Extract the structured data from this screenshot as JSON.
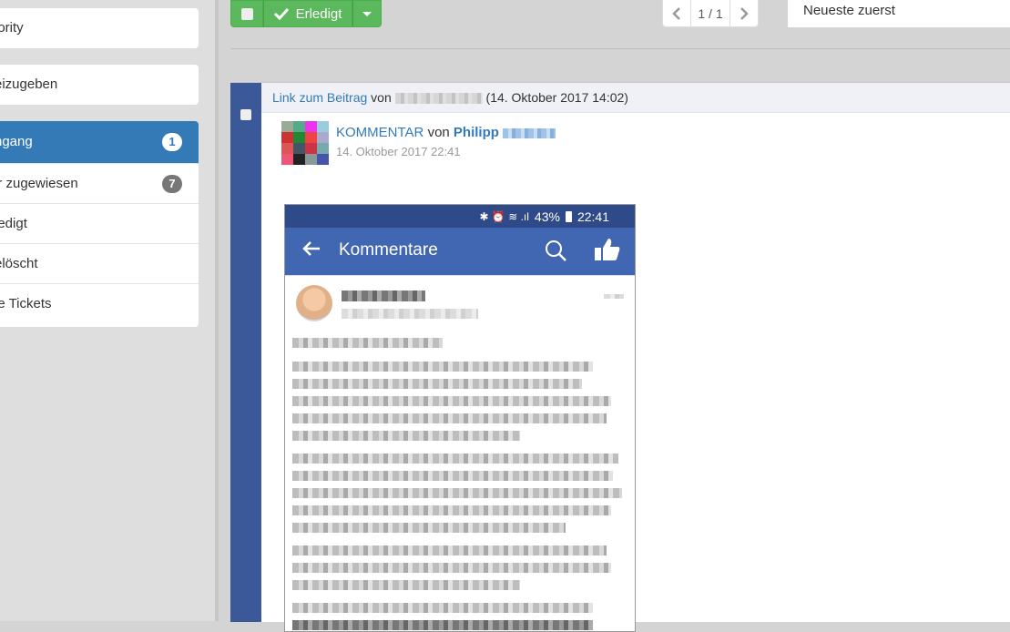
{
  "sidebar": {
    "card1": {
      "label": "iority"
    },
    "card2": {
      "label": "eizugeben"
    },
    "items": [
      {
        "label": "ngang",
        "badge": "1"
      },
      {
        "label": "ir zugewiesen",
        "badge": "7"
      },
      {
        "label": "ledigt"
      },
      {
        "label": "elöscht"
      },
      {
        "label": "le Tickets"
      }
    ]
  },
  "toolbar": {
    "done_label": "Erledigt",
    "pager_text": "1 / 1",
    "sort_label": "Neueste zuerst"
  },
  "ticket": {
    "link_label": "Link zum Beitrag",
    "by_label": "von",
    "link_date": "(14. Oktober 2017 14:02)",
    "comment_type": "KOMMENTAR",
    "comment_by": "von",
    "author_first": "Philipp",
    "comment_date": "14. Oktober 2017 22:41"
  },
  "screenshot": {
    "status_text": "43%",
    "status_time": "22:41",
    "app_title": "Kommentare"
  },
  "colors": {
    "primary": "#337ab7",
    "success": "#5cb85c",
    "facebook": "#4267b2",
    "ticket_bar": "#3b5998"
  }
}
